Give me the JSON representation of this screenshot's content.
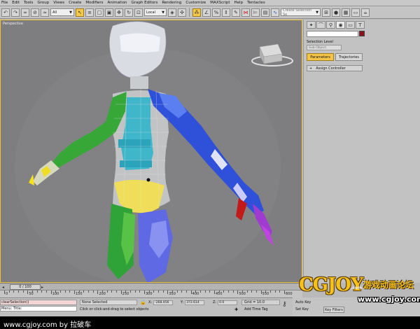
{
  "menu": [
    "File",
    "Edit",
    "Tools",
    "Group",
    "Views",
    "Create",
    "Modifiers",
    "Animation",
    "Graph Editors",
    "Rendering",
    "Customize",
    "MAXScript",
    "Help",
    "Tentacles"
  ],
  "toolbar": {
    "filter_value": "All",
    "refcoord_value": "Local",
    "selection_set_placeholder": "Create Selection Se"
  },
  "viewport": {
    "label": "Perspective",
    "viewcube_label": "BACK"
  },
  "command_panel": {
    "selection_level_label": "Selection Level",
    "sub_object_value": "Sub-Object",
    "tabs": [
      "Parameters",
      "Trajectories"
    ],
    "rollout_label": "Assign Controller",
    "rollout_sign": "+",
    "object_color": "#8b1020"
  },
  "timeline": {
    "frame_display": "0 / 100",
    "ruler_labels": [
      "0",
      "50",
      "100",
      "150",
      "200",
      "250",
      "300",
      "350",
      "400",
      "450",
      "500",
      "550",
      "600"
    ]
  },
  "status": {
    "maxscript_line1": "clearSelection()",
    "maxscript_line2": "Menu: Title:",
    "selection_text": "None Selected",
    "prompt_text": "Click or click-and-drag to select objects",
    "x_label": "X:",
    "x_value": "-268.456",
    "y_label": "Y:",
    "y_value": "373.614",
    "z_label": "Z:",
    "z_value": "0.0",
    "grid_text": "Grid = 10.0",
    "add_time_tag": "Add Time Tag"
  },
  "keys": {
    "auto_key": "Auto Key",
    "set_key": "Set Key",
    "key_filters": "Key Filters"
  },
  "watermark": {
    "brand": "CGJOY",
    "com": ".com",
    "chinese": "游戏动画论坛",
    "url": "www.cgjoy.com"
  },
  "footer": {
    "text": "www.cgjoy.com by 拉破车"
  }
}
